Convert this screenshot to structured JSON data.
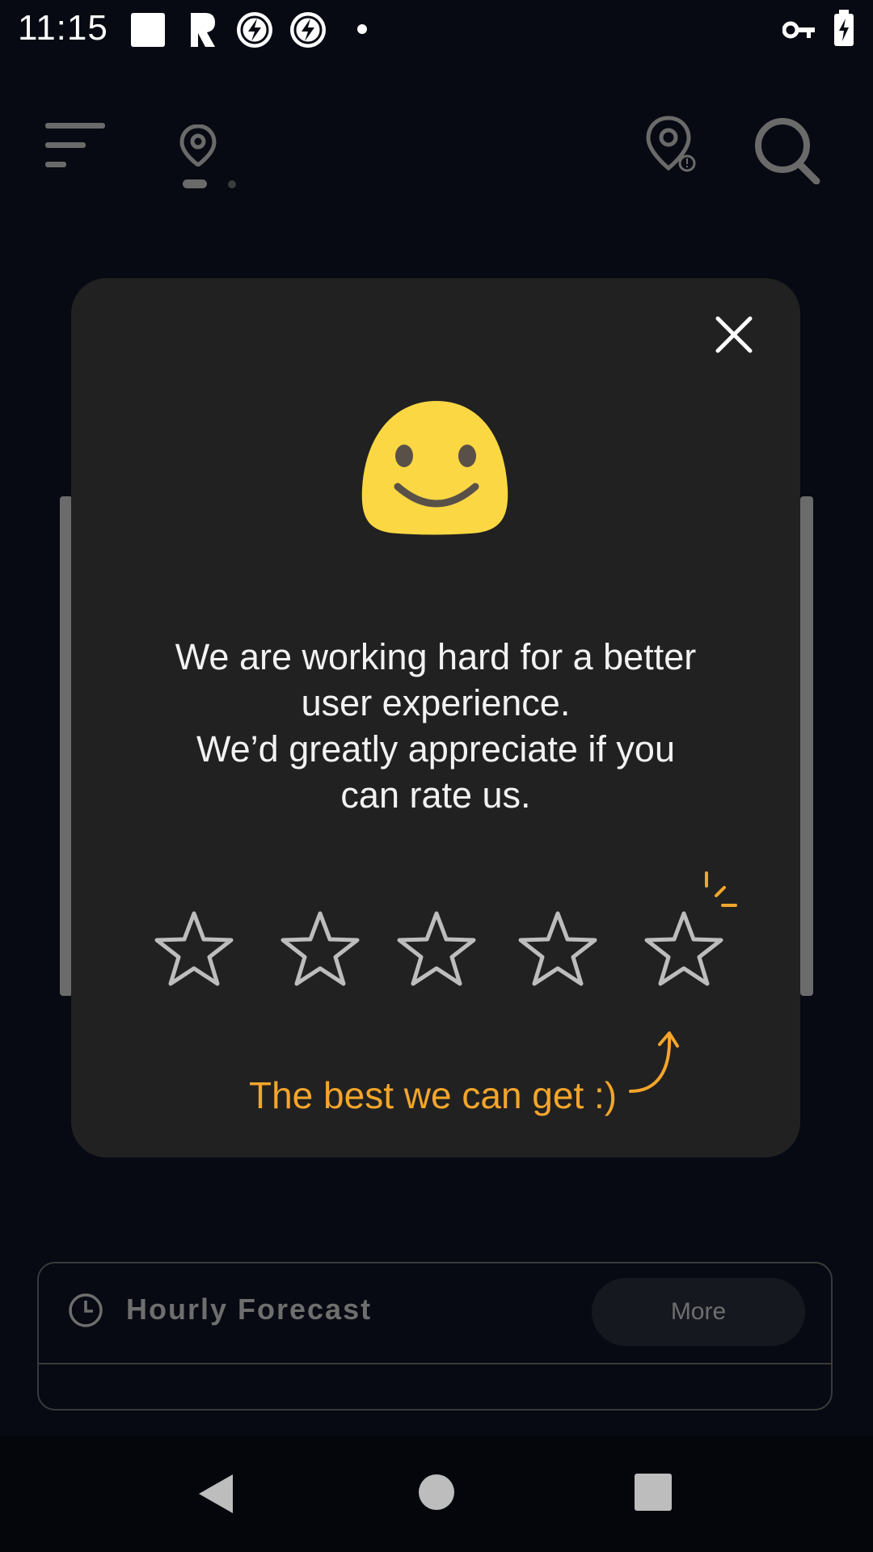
{
  "status_bar": {
    "time": "11:15",
    "icons": [
      "square-notification-icon",
      "r-app-icon",
      "flash-icon",
      "flash-icon",
      "dot-icon",
      "vpn-key-icon",
      "battery-charging-icon"
    ]
  },
  "app_bar": {
    "icons": [
      "menu-icon",
      "location-pin-icon",
      "location-alert-icon",
      "search-icon"
    ],
    "pager": {
      "page_count": 2,
      "active_index": 0
    }
  },
  "rating_dialog": {
    "emoji": "smiling-face",
    "message_lines": [
      "We are working hard for a better",
      "user experience.",
      "We’d greatly appreciate if you",
      "can rate us."
    ],
    "stars": {
      "total": 5,
      "selected": 0
    },
    "hint": "The best we can get :)",
    "accent_color": "#f4a52b"
  },
  "hourly_forecast": {
    "title": "Hourly Forecast",
    "more_label": "More"
  },
  "nav_bar": {
    "icons": [
      "back-icon",
      "home-icon",
      "recents-icon"
    ]
  }
}
